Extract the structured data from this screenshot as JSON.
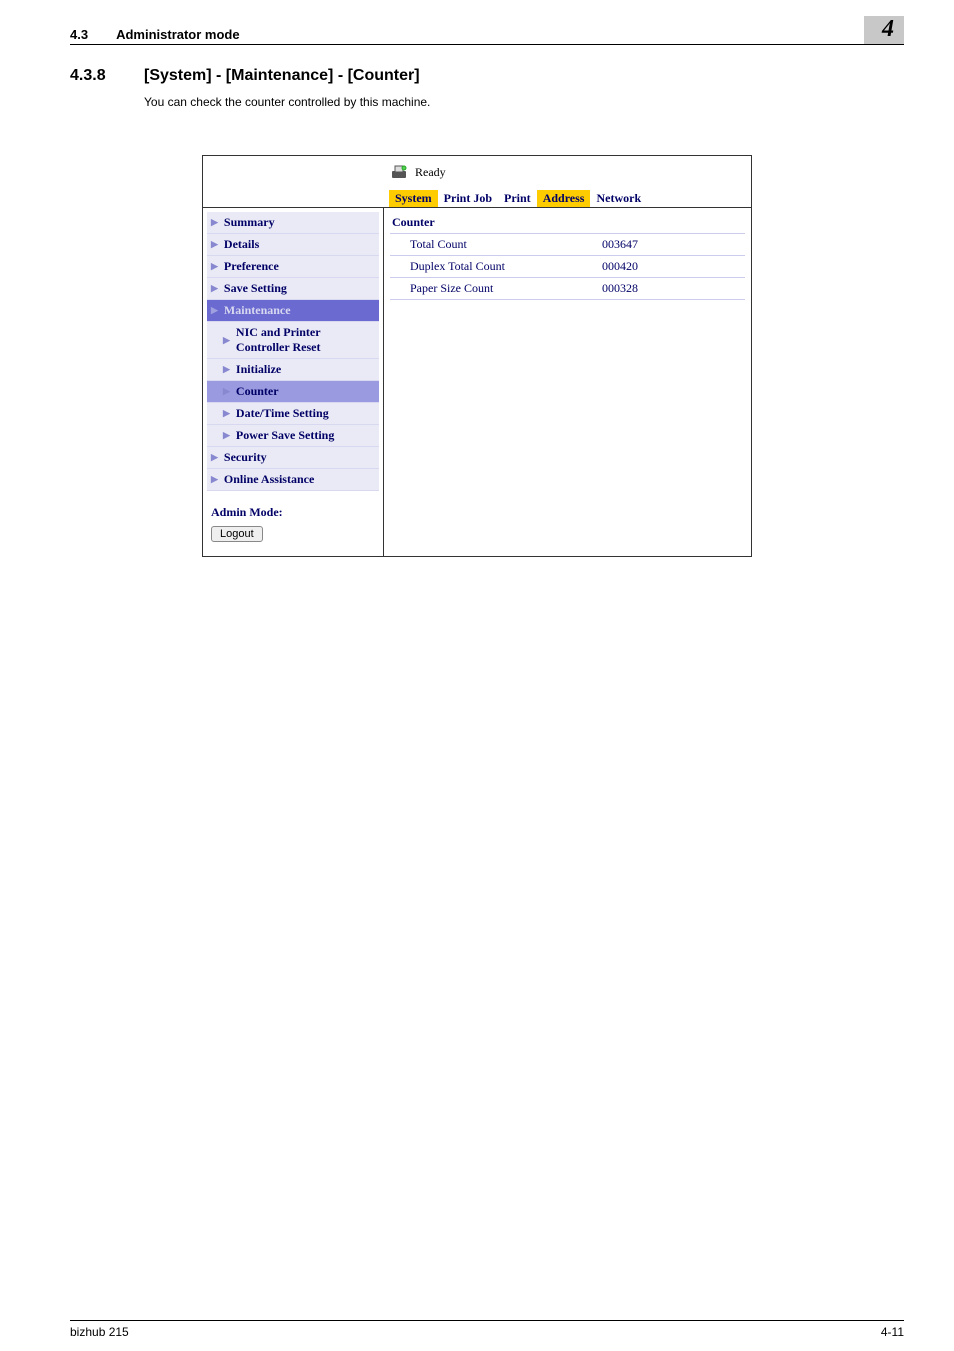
{
  "header": {
    "section_number": "4.3",
    "section_title": "Administrator mode",
    "chapter_number": "4"
  },
  "section": {
    "number": "4.3.8",
    "title": "[System] - [Maintenance] - [Counter]"
  },
  "body_text": "You can check the counter controlled by this machine.",
  "app": {
    "status": "Ready",
    "tabs": {
      "system": "System",
      "printjob": "Print Job",
      "print": "Print",
      "address": "Address",
      "network": "Network"
    },
    "sidebar": [
      {
        "label": "Summary",
        "sub": false,
        "sel": ""
      },
      {
        "label": "Details",
        "sub": false,
        "sel": ""
      },
      {
        "label": "Preference",
        "sub": false,
        "sel": ""
      },
      {
        "label": "Save Setting",
        "sub": false,
        "sel": ""
      },
      {
        "label": "Maintenance",
        "sub": false,
        "sel": "sel-dark"
      },
      {
        "label": "NIC and Printer Controller Reset",
        "sub": true,
        "sel": ""
      },
      {
        "label": "Initialize",
        "sub": true,
        "sel": ""
      },
      {
        "label": "Counter",
        "sub": true,
        "sel": "sel-mid"
      },
      {
        "label": "Date/Time Setting",
        "sub": true,
        "sel": ""
      },
      {
        "label": "Power Save Setting",
        "sub": true,
        "sel": ""
      },
      {
        "label": "Security",
        "sub": false,
        "sel": ""
      },
      {
        "label": "Online Assistance",
        "sub": false,
        "sel": ""
      }
    ],
    "admin": {
      "label": "Admin Mode:",
      "logout": "Logout"
    },
    "main": {
      "heading": "Counter",
      "rows": [
        {
          "label": "Total Count",
          "value": "003647"
        },
        {
          "label": "Duplex Total Count",
          "value": "000420"
        },
        {
          "label": "Paper Size Count",
          "value": "000328"
        }
      ]
    }
  },
  "footer": {
    "product": "bizhub 215",
    "page": "4-11"
  }
}
